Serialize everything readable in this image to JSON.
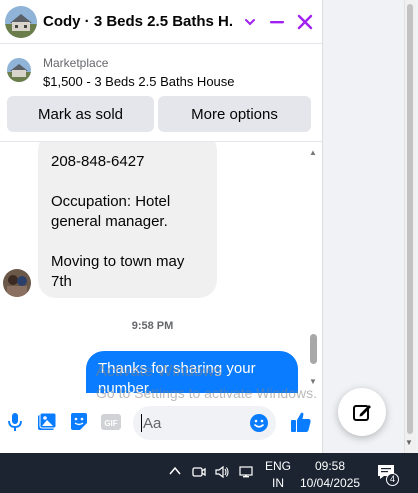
{
  "header": {
    "title": "Cody · 3 Beds 2.5 Baths H...",
    "icons": [
      "chevron-down-icon",
      "minimize-icon",
      "close-icon"
    ],
    "accent_color": "#a020f0"
  },
  "listing": {
    "source": "Marketplace",
    "item": "$1,500 - 3 Beds 2.5 Baths House",
    "buttons": [
      "Mark as sold",
      "More options"
    ]
  },
  "messages": {
    "incoming_lines": [
      "208-848-6427",
      "",
      "Occupation: Hotel general manager.",
      "",
      "Moving to town may 7th"
    ],
    "timestamp": "9:58 PM",
    "outgoing": "Thanks for sharing your number."
  },
  "watermark": {
    "line1": "Activate Windows",
    "line2": "Go to Settings to activate Windows."
  },
  "composer": {
    "placeholder": "Aa",
    "icons": [
      "microphone-icon",
      "photo-icon",
      "sticker-icon",
      "gif-icon",
      "emoji-icon",
      "thumbs-up-icon"
    ]
  },
  "taskbar": {
    "lang_top": "ENG",
    "lang_bottom": "IN",
    "time": "09:58",
    "date": "10/04/2025",
    "notification_count": "4"
  }
}
